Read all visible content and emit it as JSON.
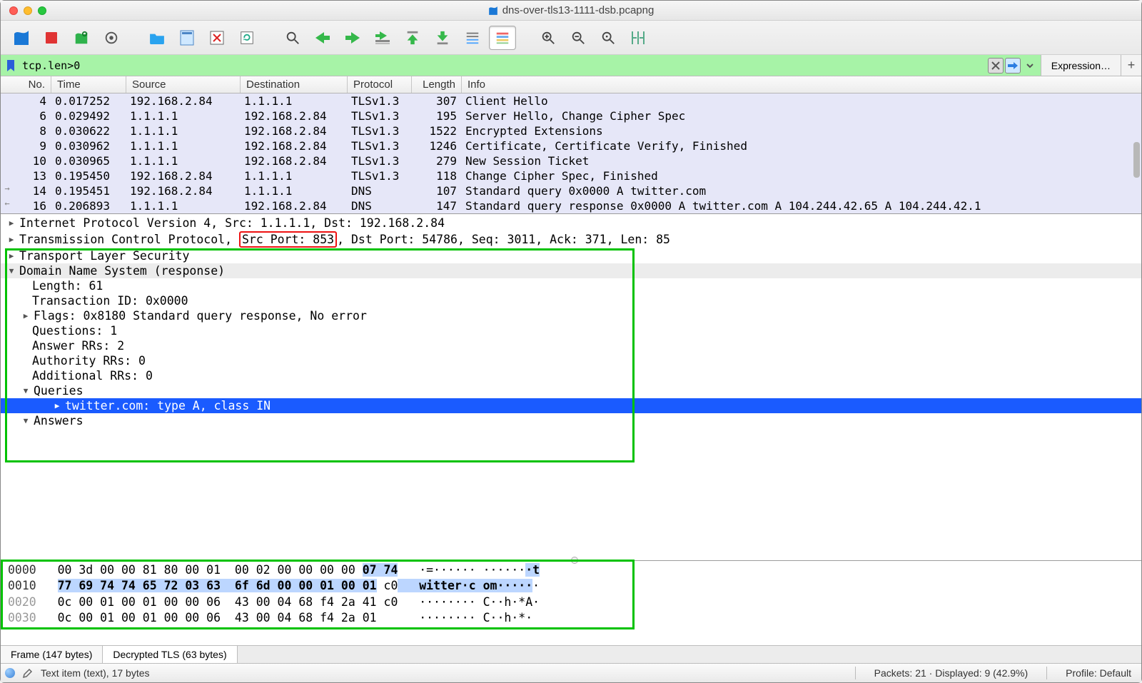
{
  "window": {
    "title": "dns-over-tls13-1111-dsb.pcapng"
  },
  "filter": {
    "value": "tcp.len>0",
    "expression_label": "Expression…"
  },
  "columns": {
    "no": "No.",
    "time": "Time",
    "source": "Source",
    "destination": "Destination",
    "protocol": "Protocol",
    "length": "Length",
    "info": "Info"
  },
  "packets": [
    {
      "no": "4",
      "time": "0.017252",
      "src": "192.168.2.84",
      "dst": "1.1.1.1",
      "proto": "TLSv1.3",
      "len": "307",
      "info": "Client Hello"
    },
    {
      "no": "6",
      "time": "0.029492",
      "src": "1.1.1.1",
      "dst": "192.168.2.84",
      "proto": "TLSv1.3",
      "len": "195",
      "info": "Server Hello, Change Cipher Spec"
    },
    {
      "no": "8",
      "time": "0.030622",
      "src": "1.1.1.1",
      "dst": "192.168.2.84",
      "proto": "TLSv1.3",
      "len": "1522",
      "info": "Encrypted Extensions"
    },
    {
      "no": "9",
      "time": "0.030962",
      "src": "1.1.1.1",
      "dst": "192.168.2.84",
      "proto": "TLSv1.3",
      "len": "1246",
      "info": "Certificate, Certificate Verify, Finished"
    },
    {
      "no": "10",
      "time": "0.030965",
      "src": "1.1.1.1",
      "dst": "192.168.2.84",
      "proto": "TLSv1.3",
      "len": "279",
      "info": "New Session Ticket"
    },
    {
      "no": "13",
      "time": "0.195450",
      "src": "192.168.2.84",
      "dst": "1.1.1.1",
      "proto": "TLSv1.3",
      "len": "118",
      "info": "Change Cipher Spec, Finished"
    },
    {
      "no": "14",
      "time": "0.195451",
      "src": "192.168.2.84",
      "dst": "1.1.1.1",
      "proto": "DNS",
      "len": "107",
      "info": "Standard query 0x0000 A twitter.com"
    },
    {
      "no": "16",
      "time": "0.206893",
      "src": "1.1.1.1",
      "dst": "192.168.2.84",
      "proto": "DNS",
      "len": "147",
      "info": "Standard query response 0x0000 A twitter.com A 104.244.42.65 A 104.244.42.1"
    }
  ],
  "details": {
    "ip": "Internet Protocol Version 4, Src: 1.1.1.1, Dst: 192.168.2.84",
    "tcp_pre": "Transmission Control Protocol, ",
    "tcp_hl": "Src Port: 853",
    "tcp_post": ", Dst Port: 54786, Seq: 3011, Ack: 371, Len: 85",
    "tls": "Transport Layer Security",
    "dns": "Domain Name System (response)",
    "dns_len": "Length: 61",
    "dns_tid": "Transaction ID: 0x0000",
    "dns_flags": "Flags: 0x8180 Standard query response, No error",
    "dns_q": "Questions: 1",
    "dns_arr": "Answer RRs: 2",
    "dns_auth": "Authority RRs: 0",
    "dns_add": "Additional RRs: 0",
    "queries": "Queries",
    "query_item": "twitter.com: type A, class IN",
    "answers": "Answers"
  },
  "hex": {
    "l0_off": "0000",
    "l0_hex1": "00 3d 00 00 81 80 00 01  00 02 00 00 00 00 ",
    "l0_hexhl": "07 74",
    "l0_asc": "   ·=······ ······",
    "l0_aschl": "·t",
    "l1_off": "0010",
    "l1_hexhl": "77 69 74 74 65 72 03 63  6f 6d 00 00 01 00 01",
    "l1_hex2": " c0",
    "l1_aschl": "   witter·c om·····",
    "l1_asc2": "·",
    "l2_off": "0020",
    "l2_hex": "0c 00 01 00 01 00 00 06  43 00 04 68 f4 2a 41 c0",
    "l2_asc": "   ········ C··h·*A·",
    "l3_off": "0030",
    "l3_hex": "0c 00 01 00 01 00 00 06  43 00 04 68 f4 2a 01   ",
    "l3_asc": "   ········ C··h·*· "
  },
  "tabs": {
    "frame": "Frame (147 bytes)",
    "decrypted": "Decrypted TLS (63 bytes)"
  },
  "status": {
    "left": "Text item (text), 17 bytes",
    "mid": "Packets: 21 · Displayed: 9 (42.9%)",
    "right": "Profile: Default"
  }
}
